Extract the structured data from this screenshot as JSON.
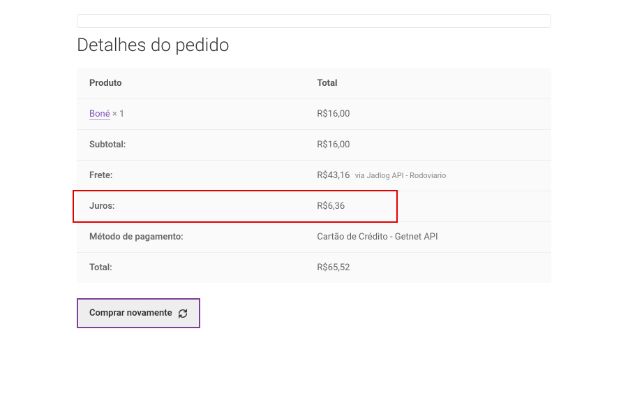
{
  "heading": "Detalhes do pedido",
  "table": {
    "header": {
      "product": "Produto",
      "total": "Total"
    },
    "product_row": {
      "name": "Boné",
      "qty": "× 1",
      "price": "R$16,00"
    },
    "subtotal": {
      "label": "Subtotal:",
      "value": "R$16,00"
    },
    "shipping": {
      "label": "Frete:",
      "value": "R$43,16",
      "note": "via Jadlog API - Rodoviario"
    },
    "interest": {
      "label": "Juros:",
      "value": "R$6,36"
    },
    "payment": {
      "label": "Método de pagamento:",
      "value": "Cartão de Crédito - Getnet API"
    },
    "total": {
      "label": "Total:",
      "value": "R$65,52"
    }
  },
  "button": {
    "reorder": "Comprar novamente"
  }
}
